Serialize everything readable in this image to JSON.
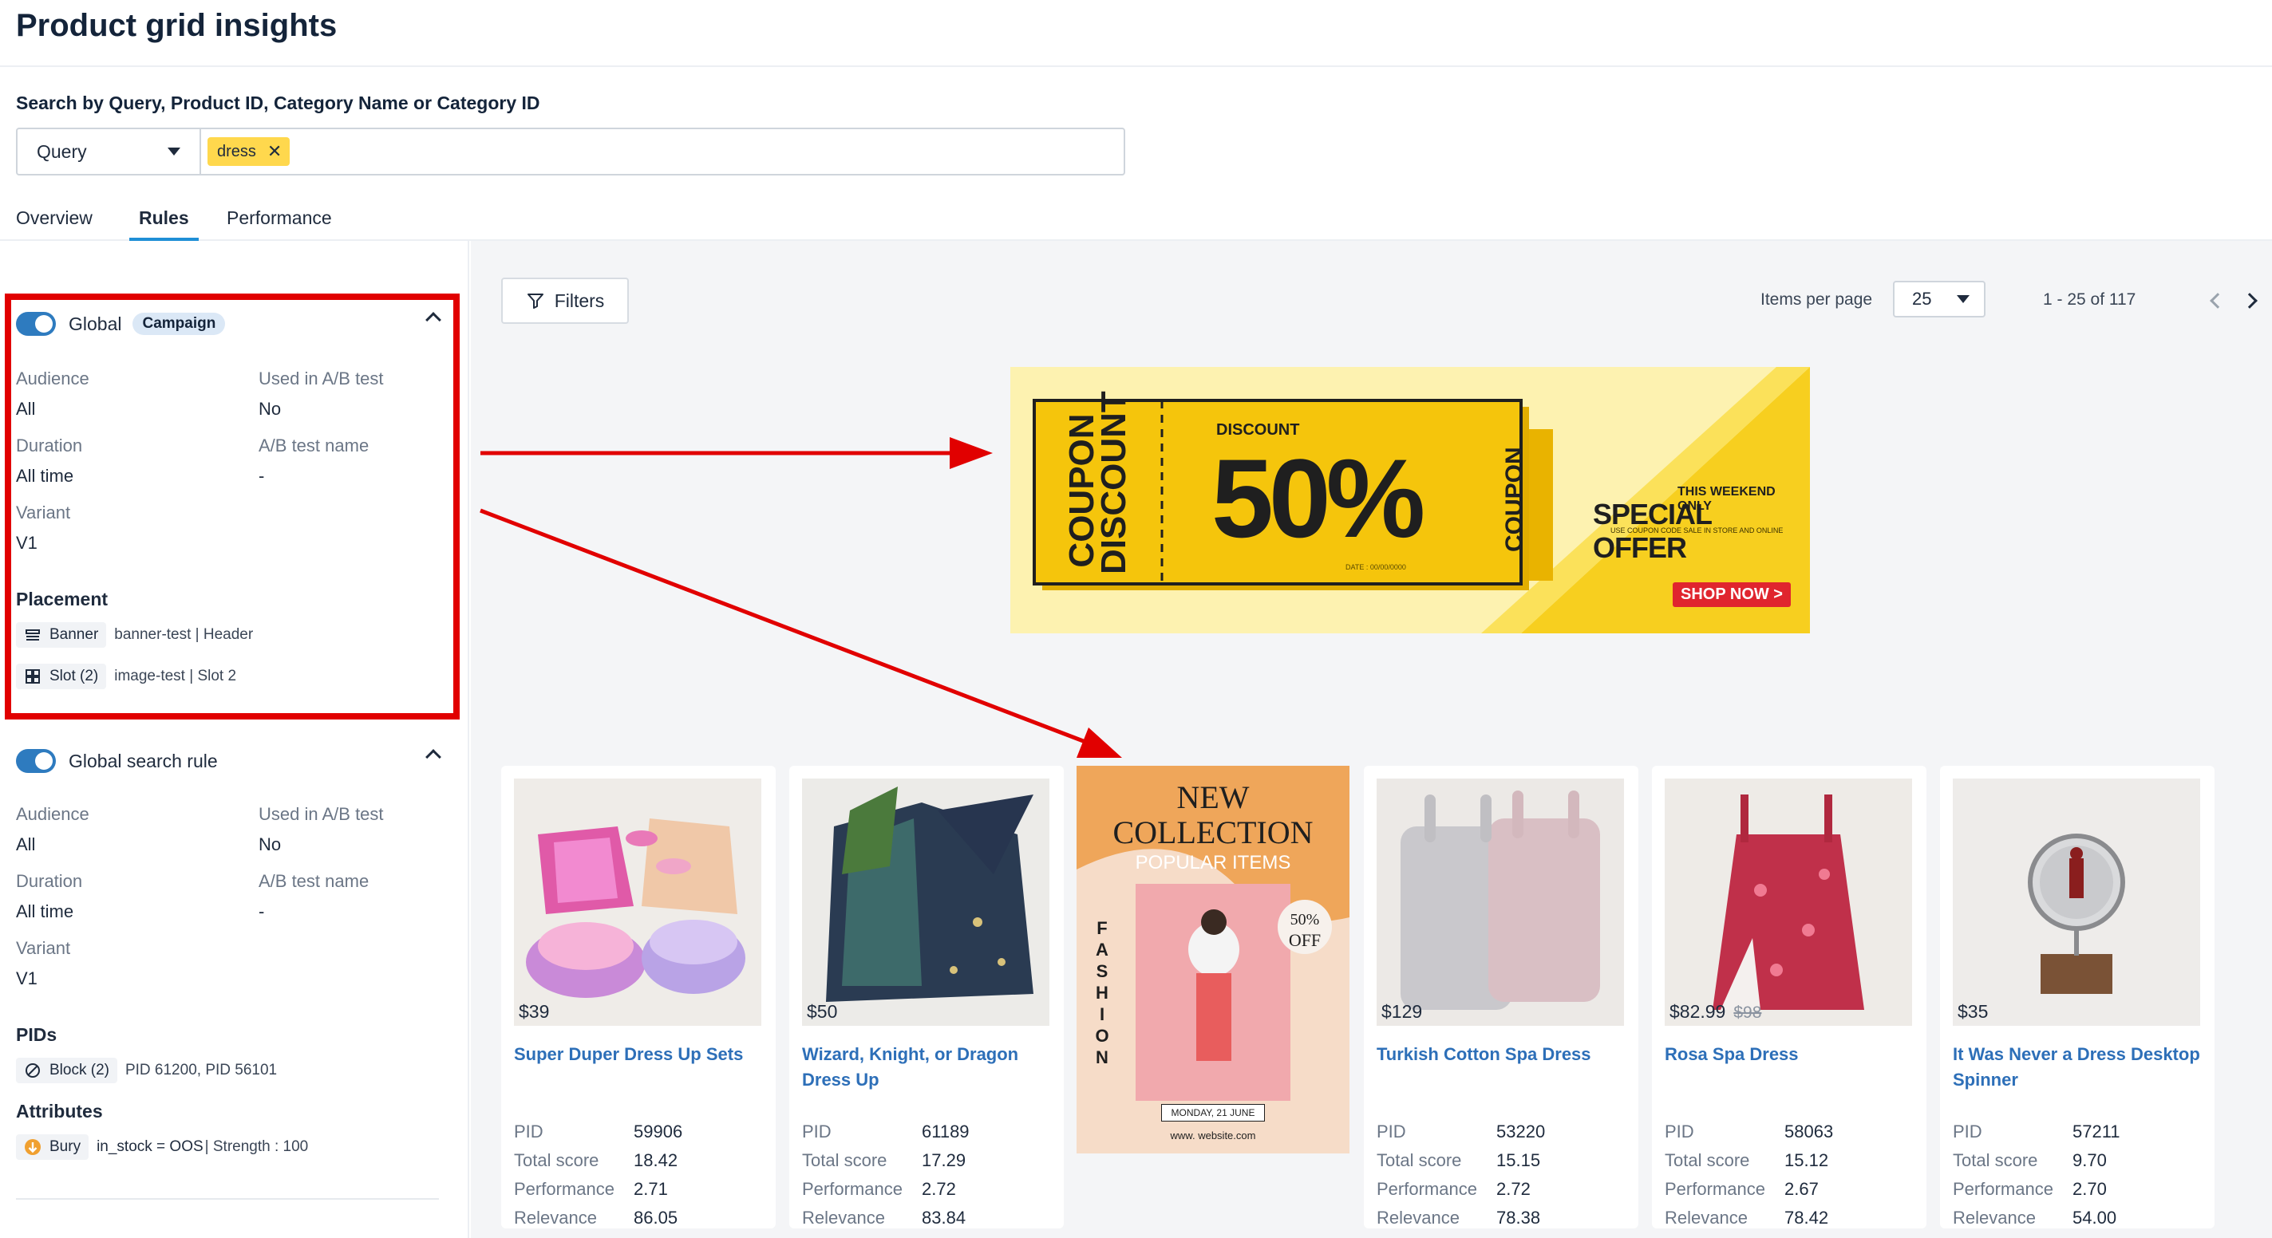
{
  "header": {
    "title": "Product grid insights"
  },
  "search": {
    "label": "Search by Query, Product ID, Category Name or Category ID",
    "type_selected": "Query",
    "chips": [
      "dress"
    ]
  },
  "tabs": [
    {
      "label": "Overview",
      "active": false
    },
    {
      "label": "Rules",
      "active": true
    },
    {
      "label": "Performance",
      "active": false
    }
  ],
  "rules": [
    {
      "name": "Global",
      "badge": "Campaign",
      "enabled": true,
      "fields": {
        "audience_label": "Audience",
        "audience": "All",
        "ab_label": "Used in A/B test",
        "ab": "No",
        "duration_label": "Duration",
        "duration": "All time",
        "ab_name_label": "A/B test name",
        "ab_name": "-",
        "variant_label": "Variant",
        "variant": "V1"
      },
      "placement_title": "Placement",
      "placements": [
        {
          "tag": "Banner",
          "detail": "banner-test | Header",
          "icon": "banner-icon"
        },
        {
          "tag": "Slot (2)",
          "detail": "image-test | Slot 2",
          "icon": "grid-icon"
        }
      ]
    },
    {
      "name": "Global search rule",
      "enabled": true,
      "fields": {
        "audience_label": "Audience",
        "audience": "All",
        "ab_label": "Used in A/B test",
        "ab": "No",
        "duration_label": "Duration",
        "duration": "All time",
        "ab_name_label": "A/B test name",
        "ab_name": "-",
        "variant_label": "Variant",
        "variant": "V1"
      },
      "pids_title": "PIDs",
      "pids": {
        "tag": "Block (2)",
        "detail": "PID 61200, PID 56101",
        "icon": "block-icon"
      },
      "attributes_title": "Attributes",
      "attributes": {
        "tag": "Bury",
        "detail": "in_stock = OOS",
        "strength": "| Strength : 100",
        "icon": "bury-icon"
      }
    }
  ],
  "toolbar": {
    "filters_label": "Filters",
    "items_per_page_label": "Items per page",
    "items_per_page": "25",
    "range": "1 - 25 of 117"
  },
  "banner": {
    "coupon_text": "COUPON DISCOUNT",
    "discount_label": "DISCOUNT",
    "discount_value": "50%",
    "coupon_side": "COUPON",
    "weekend": "THIS WEEKEND ONLY",
    "special_offer": "SPECIAL OFFER",
    "fine_print": "USE COUPON CODE SALE IN STORE AND ONLINE",
    "shop_now": "SHOP NOW >",
    "date": "DATE : 00/00/0000"
  },
  "promo": {
    "new": "NEW",
    "collection": "COLLECTION",
    "popular": "POPULAR ITEMS",
    "fashion": "FASHION",
    "off_pct": "50%",
    "off": "OFF",
    "date": "MONDAY, 21 JUNE",
    "site": "www. website.com"
  },
  "product_labels": {
    "pid": "PID",
    "total_score": "Total score",
    "performance": "Performance",
    "relevance": "Relevance"
  },
  "products": [
    {
      "name": "Super Duper Dress Up Sets",
      "price": "$39",
      "pid": "59906",
      "total_score": "18.42",
      "performance": "2.71",
      "relevance": "86.05"
    },
    {
      "name": "Wizard, Knight, or Dragon Dress Up",
      "price": "$50",
      "pid": "61189",
      "total_score": "17.29",
      "performance": "2.72",
      "relevance": "83.84"
    },
    {
      "name": "Turkish Cotton Spa Dress",
      "price": "$129",
      "pid": "53220",
      "total_score": "15.15",
      "performance": "2.72",
      "relevance": "78.38"
    },
    {
      "name": "Rosa Spa Dress",
      "price": "$82.99",
      "old_price": "$98",
      "pid": "58063",
      "total_score": "15.12",
      "performance": "2.67",
      "relevance": "78.42"
    },
    {
      "name": "It Was Never a Dress Desktop Spinner",
      "price": "$35",
      "pid": "57211",
      "total_score": "9.70",
      "performance": "2.70",
      "relevance": "54.00"
    }
  ],
  "colors": {
    "accent": "#2e7bbf",
    "highlight": "#e10000",
    "chip": "#ffd84d",
    "link": "#2d6fb8"
  }
}
